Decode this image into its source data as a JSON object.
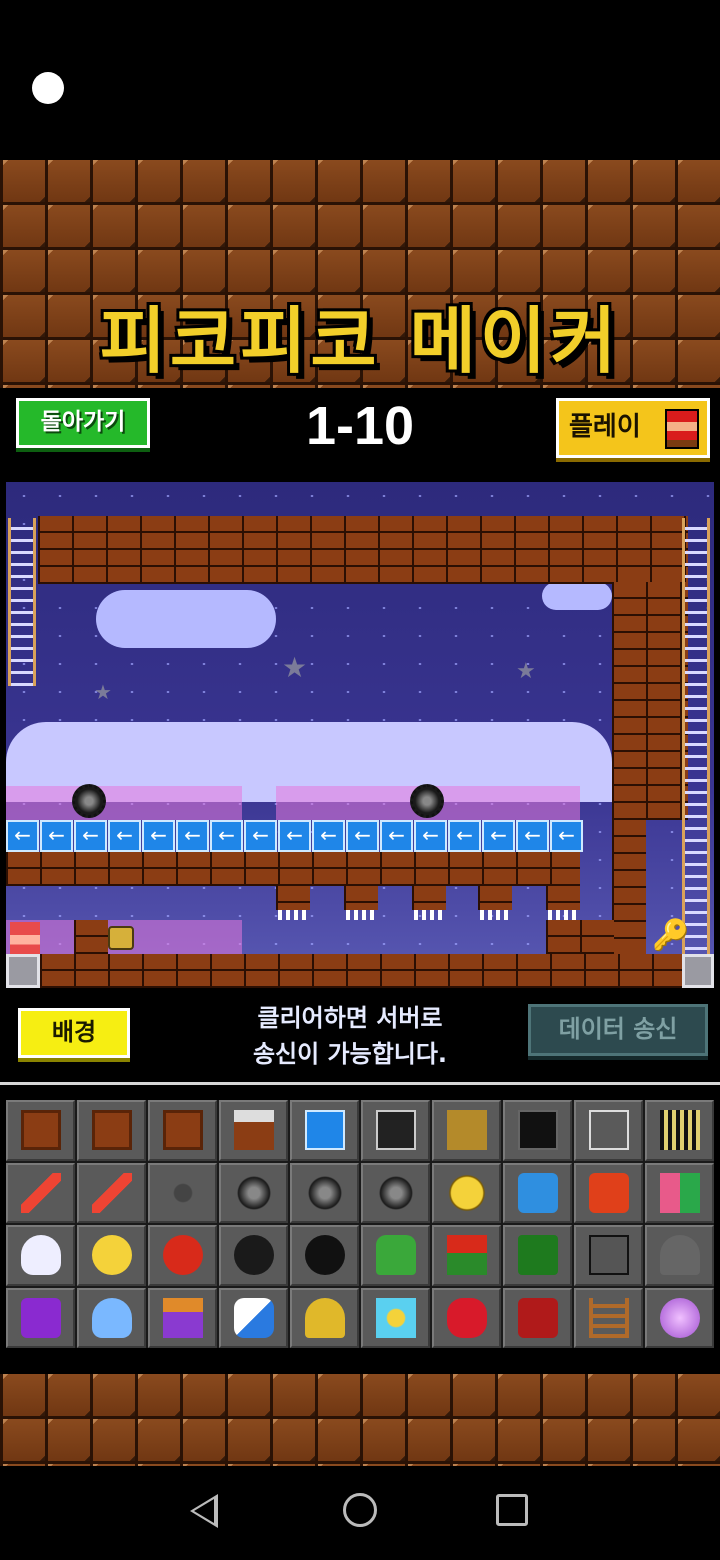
{
  "app": {
    "title": "피코피코 메이커"
  },
  "toolbar": {
    "back_label": "돌아가기",
    "level": "1-10",
    "play_label": "플레이"
  },
  "infobar": {
    "background_label": "배경",
    "info_line1": "클리어하면 서버로",
    "info_line2": "송신이 가능합니다.",
    "send_label": "데이터 송신"
  },
  "stage": {
    "arrow_glyph": "←",
    "star_glyph": "★",
    "key_glyph": "🔑"
  },
  "palette": {
    "items": [
      "brick-block-icon",
      "brick-vertical-move-icon",
      "brick-horizontal-move-icon",
      "spike-brick-move-icon",
      "conveyor-blocks-icon",
      "down-arrow-crate-icon",
      "gold-block-icon",
      "black-block-icon",
      "transparent-block-icon",
      "cage-block-icon",
      "fire-bar-icon",
      "fire-bar-short-icon",
      "chain-ball-icon",
      "spike-ball-icon",
      "spike-ball-vertical-icon",
      "spike-ball-horizontal-icon",
      "coin-icon",
      "blue-switch-block-icon",
      "red-switch-block-icon",
      "color-blocks-icon",
      "ghost-icon",
      "chick-icon",
      "red-bird-icon",
      "black-blob-icon",
      "bomb-icon",
      "cactus-icon",
      "piranha-plant-icon",
      "green-pipe-icon",
      "cannon-icon",
      "launcher-icon",
      "purple-boot-icon",
      "wings-icon",
      "purple-potion-icon",
      "capsule-icon",
      "key-icon",
      "bubble-shield-icon",
      "red-gem-icon",
      "red-chest-icon",
      "ladder-icon",
      "purple-orb-icon"
    ]
  },
  "colors": {
    "logo_yellow": "#f2cf2a",
    "back_green": "#25b92a",
    "play_yellow": "#f4c51b",
    "bg_button_yellow": "#f6ee12",
    "send_disabled": "#2d4a4f",
    "conveyor_blue": "#1f86e8",
    "brick": "#8b3d14"
  }
}
